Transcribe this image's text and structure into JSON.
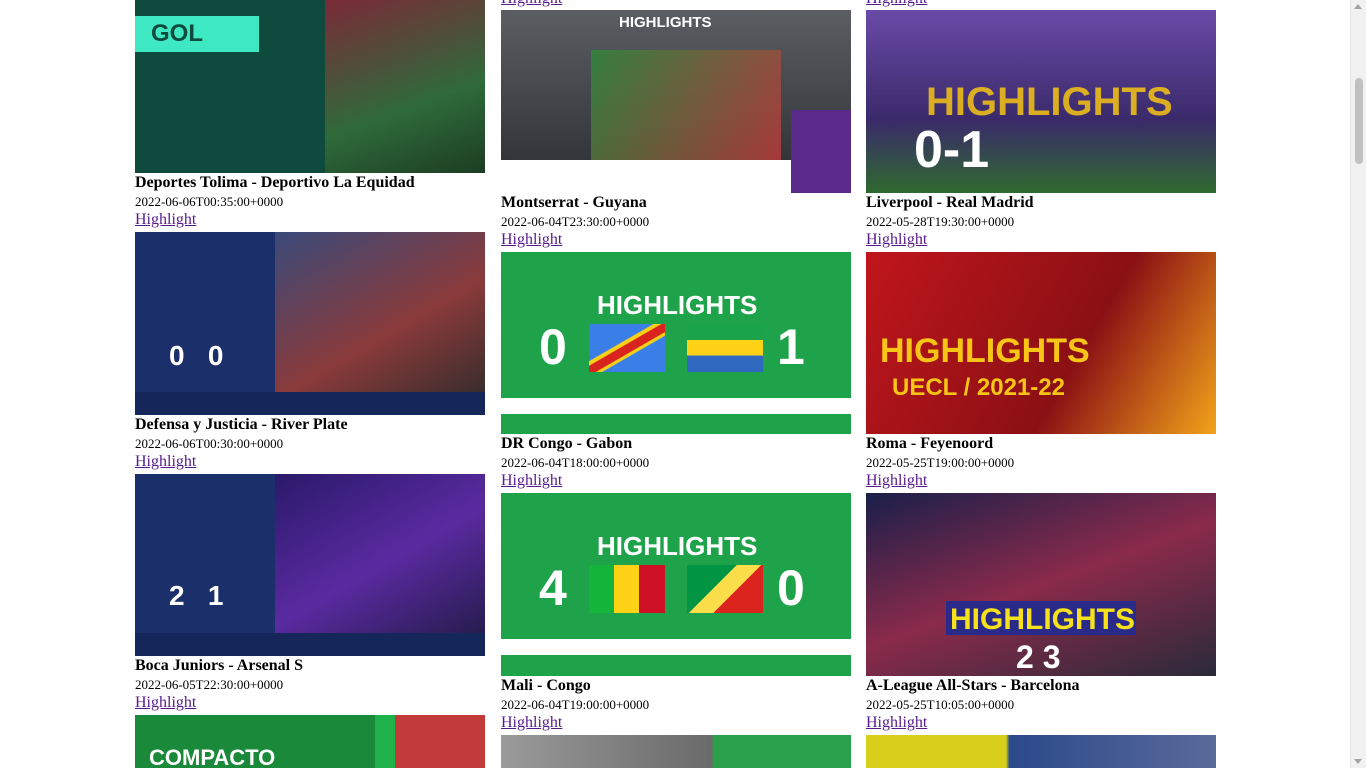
{
  "link_label": "Highlight",
  "columns": [
    {
      "cards": [
        {
          "title": "Deportes Tolima - Deportivo La Equidad",
          "date": "2022-06-06T00:35:00+0000",
          "thumb_text": "GOL",
          "thumb_bg": "#0f4a3f",
          "accent": "#3de8c2"
        },
        {
          "title": "Defensa y Justicia - River Plate",
          "date": "2022-06-06T00:30:00+0000",
          "thumb_text": "0   0",
          "thumb_bg": "#1b2f6b",
          "accent": "#ffffff"
        },
        {
          "title": "Boca Juniors - Arsenal S",
          "date": "2022-06-05T22:30:00+0000",
          "thumb_text": "2   1",
          "thumb_bg": "#1b2f6b",
          "accent": "#ffffff"
        },
        {
          "title": "",
          "date": "",
          "thumb_text": "COMPACTO",
          "thumb_bg": "#1fb24a",
          "accent": "#ffffff"
        }
      ]
    },
    {
      "cards": [
        {
          "title": "Montserrat - Guyana",
          "date": "2022-06-04T23:30:00+0000",
          "thumb_text": "HIGHLIGHTS",
          "thumb_bg": "#3a3d3f",
          "accent": "#ffffff"
        },
        {
          "title": "DR Congo - Gabon",
          "date": "2022-06-04T18:00:00+0000",
          "thumb_text": "HIGHLIGHTS",
          "thumb_bg": "#1ea34a",
          "accent": "#ffffff"
        },
        {
          "title": "Mali - Congo",
          "date": "2022-06-04T19:00:00+0000",
          "thumb_text": "HIGHLIGHTS",
          "thumb_bg": "#1ea34a",
          "accent": "#ffffff"
        },
        {
          "title": "",
          "date": "",
          "thumb_text": "",
          "thumb_bg": "#2aa04a",
          "accent": "#ffffff"
        }
      ]
    },
    {
      "cards": [
        {
          "title": "Liverpool - Real Madrid",
          "date": "2022-05-28T19:30:00+0000",
          "thumb_text": "0-1",
          "thumb_bg": "#4a2b8a",
          "accent": "#f7c515"
        },
        {
          "title": "Roma - Feyenoord",
          "date": "2022-05-25T19:00:00+0000",
          "thumb_text": "HIGHLIGHTS",
          "thumb_bg": "#b3181e",
          "accent": "#f7c515"
        },
        {
          "title": "A-League All-Stars - Barcelona",
          "date": "2022-05-25T10:05:00+0000",
          "thumb_text": "HIGHLIGHTS",
          "thumb_bg": "#3b3f7a",
          "accent": "#f7e11a"
        },
        {
          "title": "",
          "date": "",
          "thumb_text": "",
          "thumb_bg": "#d8cf1a",
          "accent": "#2b7a2b"
        }
      ]
    }
  ]
}
